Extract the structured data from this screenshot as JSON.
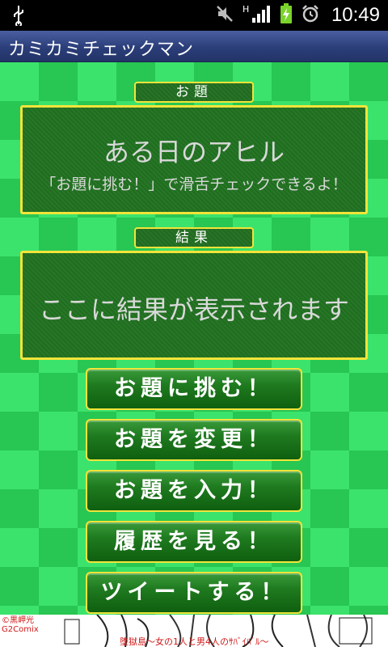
{
  "status_bar": {
    "time": "10:49",
    "icons": [
      "usb-icon",
      "mute-icon",
      "signal-h-icon",
      "battery-charging-icon",
      "alarm-icon"
    ]
  },
  "app": {
    "title": "カミカミチェックマン"
  },
  "topic": {
    "tag_label": "お題",
    "text": "ある日のアヒル",
    "hint": "「お題に挑む！」で滑舌チェックできるよ！"
  },
  "result": {
    "tag_label": "結果",
    "text": "ここに結果が表示されます"
  },
  "buttons": {
    "challenge": "お題に挑む！",
    "change": "お題を変更！",
    "input": "お題を入力！",
    "history": "履歴を見る！",
    "tweet": "ツイートする！"
  },
  "ad": {
    "credit_line1": "©黒岬光",
    "credit_line2": "G2Comix",
    "caption": "堕獄島〜女の1人と男4人のｻﾊﾞｲﾊﾞﾙ〜"
  },
  "colors": {
    "accent_border": "#f2e43a",
    "panel_bg": "#1e6e1e",
    "checker_light": "#3be36c",
    "checker_dark": "#28c652",
    "titlebar": "#2b3e7a"
  }
}
